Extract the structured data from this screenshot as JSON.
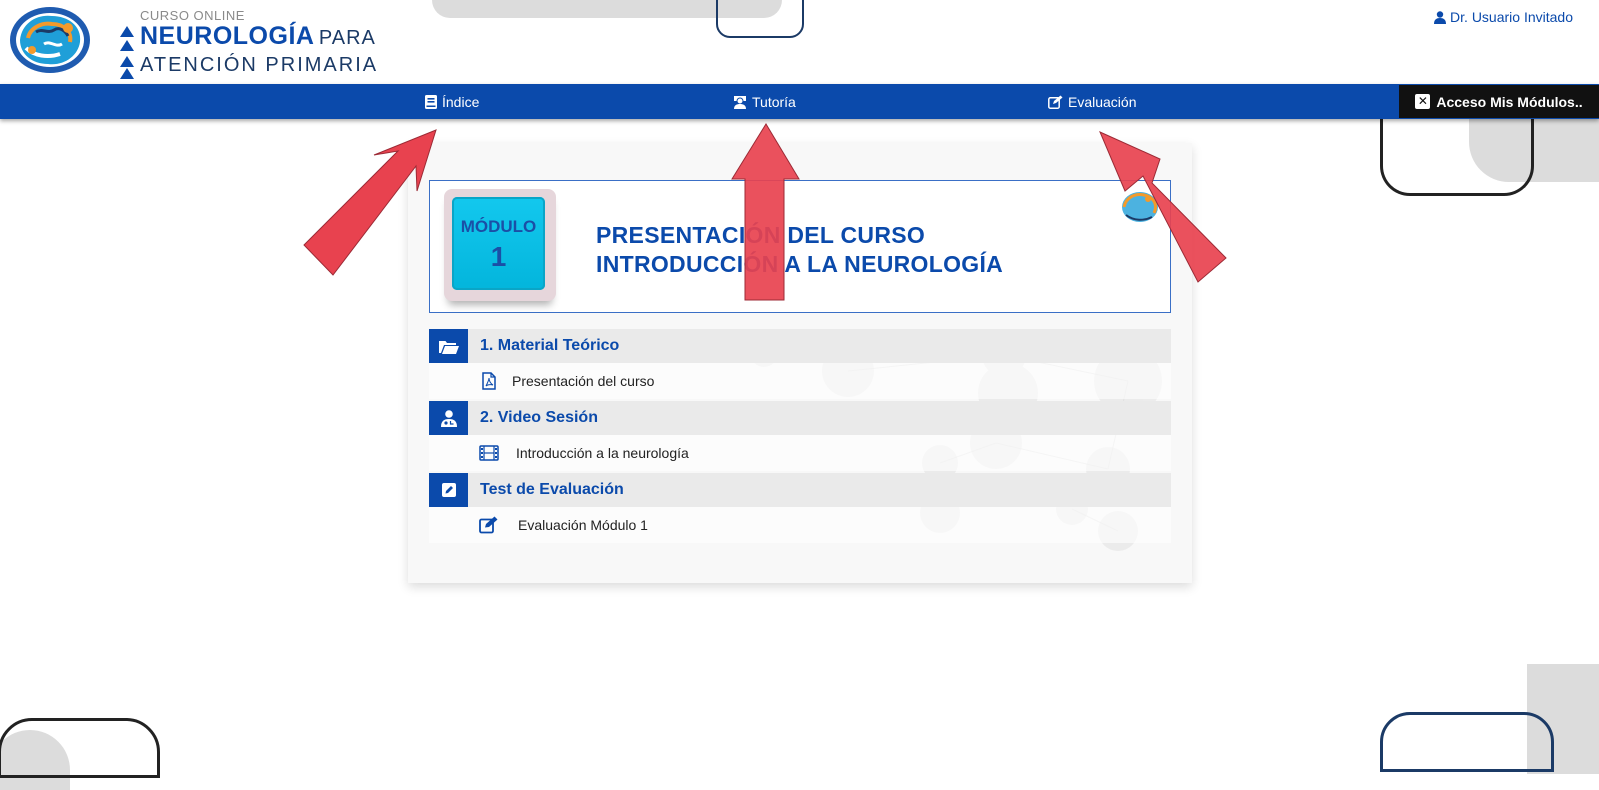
{
  "header": {
    "brand_sub": "CURSO ONLINE",
    "brand_main": "NEUROLOGÍA",
    "brand_para": "PARA",
    "brand_line2": "ATENCIÓN  PRIMARIA",
    "user_label": "Dr. Usuario Invitado",
    "user_icon": "user-icon"
  },
  "navbar": {
    "items": [
      {
        "label": "Índice",
        "icon": "book-icon"
      },
      {
        "label": "Tutoría",
        "icon": "tutor-icon"
      },
      {
        "label": "Evaluación",
        "icon": "edit-icon"
      }
    ],
    "access_label": "Acceso Mis Módulos..",
    "access_icon": "close-icon"
  },
  "banner": {
    "module_label": "MÓDULO",
    "module_number": "1",
    "title_line1": "PRESENTACIÓN DEL CURSO",
    "title_line2": "INTRODUCCIÓN A LA NEUROLOGÍA"
  },
  "sections": [
    {
      "title": "1. Material Teórico",
      "icon": "folder-open-icon",
      "items": [
        {
          "label": "Presentación del curso",
          "icon": "pdf-file-icon"
        }
      ]
    },
    {
      "title": "2. Video Sesión",
      "icon": "doctor-icon",
      "items": [
        {
          "label": "Introducción a la neurología",
          "icon": "film-icon"
        }
      ]
    },
    {
      "title": "Test de Evaluación",
      "icon": "pencil-icon",
      "items": [
        {
          "label": "Evaluación Módulo 1",
          "icon": "edit-icon"
        }
      ]
    }
  ],
  "colors": {
    "primary": "#0b4aab",
    "dark": "#111111",
    "module_cyan": "#13c8ee",
    "arrow_red": "#e8424f",
    "section_bg": "#eaeaea"
  }
}
